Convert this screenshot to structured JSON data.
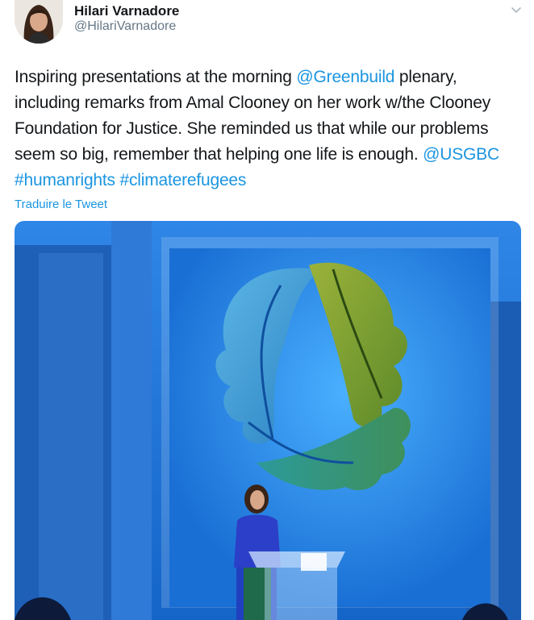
{
  "tweet": {
    "author_name": "Hilari Varnadore",
    "author_handle": "@HilariVarnadore",
    "text_1": "Inspiring presentations at the morning ",
    "mention_1": "@Greenbuild",
    "text_2": " plenary, including remarks from Amal Clooney on her work w/the Clooney Foundation for Justice. She reminded us that while our problems seem so big, remember that helping one life is enough. ",
    "mention_2": "@USGBC",
    "hashtag_1": "#humanrights",
    "hashtag_2": "#climaterefugees",
    "translate_label": "Traduire le Tweet"
  },
  "icons": {
    "menu": "chevron-down-icon"
  },
  "colors": {
    "link": "#1b95e0",
    "text": "#14171a",
    "secondary": "#657786",
    "stage_blue": "#1f7fe0",
    "leaf_blue": "#4aa3d6",
    "leaf_green": "#7a9a2c"
  }
}
